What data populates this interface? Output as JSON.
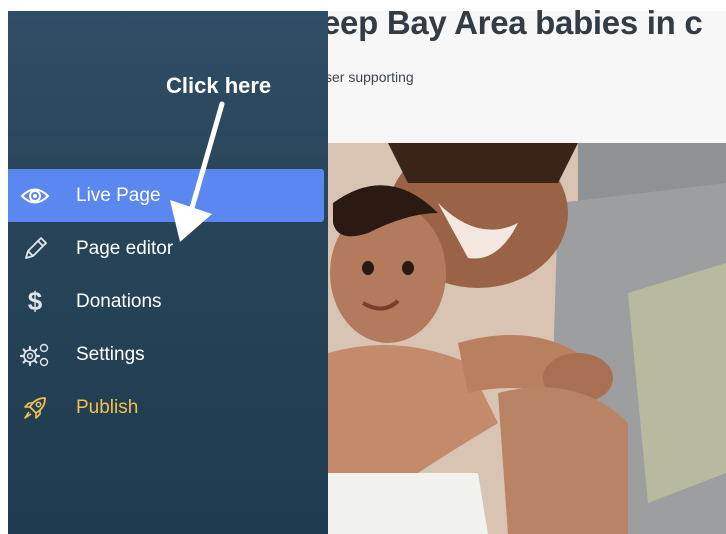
{
  "page": {
    "title": "eep Bay Area babies in c",
    "subtitle": "ser supporting"
  },
  "annotation": {
    "text": "Click here"
  },
  "sidebar": {
    "items": [
      {
        "label": "Live Page",
        "icon": "eye-icon",
        "active": true
      },
      {
        "label": "Page editor",
        "icon": "pencil-icon"
      },
      {
        "label": "Donations",
        "icon": "dollar-icon",
        "glyph": "$"
      },
      {
        "label": "Settings",
        "icon": "gears-icon"
      },
      {
        "label": "Publish",
        "icon": "rocket-icon"
      }
    ]
  },
  "colors": {
    "active": "#5b87f0",
    "publish": "#f2c14e",
    "sidebar_top": "#2f4d66",
    "sidebar_bottom": "#1e3b50"
  }
}
